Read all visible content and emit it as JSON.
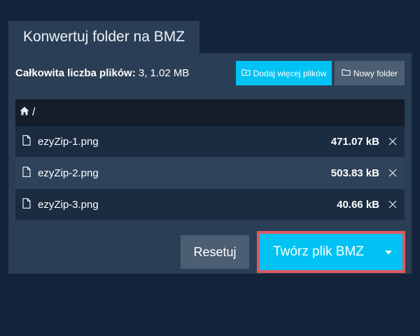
{
  "tab": {
    "title": "Konwertuj folder na BMZ"
  },
  "summary": {
    "label": "Całkowita liczba plików:",
    "value": "3, 1.02 MB"
  },
  "toolbar": {
    "add_files_label": "Dodaj więcej plików",
    "new_folder_label": "Nowy folder"
  },
  "breadcrumb": {
    "path": "/"
  },
  "files": [
    {
      "name": "ezyZip-1.png",
      "size": "471.07 kB"
    },
    {
      "name": "ezyZip-2.png",
      "size": "503.83 kB"
    },
    {
      "name": "ezyZip-3.png",
      "size": "40.66 kB"
    }
  ],
  "actions": {
    "reset_label": "Resetuj",
    "create_label": "Twórz plik BMZ"
  },
  "colors": {
    "background": "#13233a",
    "panel": "#2a3e56",
    "accent": "#00c2f3",
    "secondary_button": "#4b5e72",
    "highlight_border": "#e0585f"
  },
  "icons": {
    "add_files": "add-folder-icon",
    "new_folder": "folder-icon",
    "home": "home-icon",
    "file": "file-icon",
    "remove": "close-icon",
    "dropdown": "caret-down-icon"
  }
}
